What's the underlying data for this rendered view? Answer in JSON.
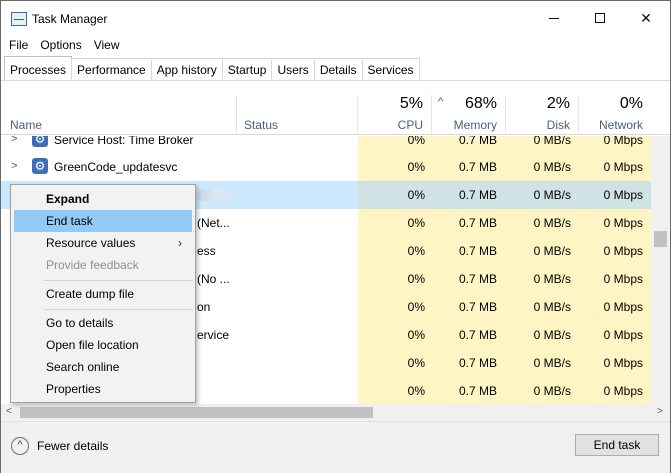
{
  "window": {
    "title": "Task Manager"
  },
  "menu": [
    "File",
    "Options",
    "View"
  ],
  "tabs": [
    "Processes",
    "Performance",
    "App history",
    "Startup",
    "Users",
    "Details",
    "Services"
  ],
  "header": {
    "name": "Name",
    "status": "Status",
    "cpu": {
      "pct": "5%",
      "label": "CPU"
    },
    "memory": {
      "pct": "68%",
      "label": "Memory"
    },
    "disk": {
      "pct": "2%",
      "label": "Disk"
    },
    "network": {
      "pct": "0%",
      "label": "Network"
    }
  },
  "rows": [
    {
      "name": "Service Host: Time Broker",
      "frag": "",
      "cpu": "0%",
      "mem": "0.7 MB",
      "disk": "0 MB/s",
      "net": "0 Mbps"
    },
    {
      "name": "GreenCode_updatesvc",
      "frag": "",
      "cpu": "0%",
      "mem": "0.7 MB",
      "disk": "0 MB/s",
      "net": "0 Mbps"
    },
    {
      "name": "",
      "frag": "",
      "cpu": "0%",
      "mem": "0.7 MB",
      "disk": "0 MB/s",
      "net": "0 Mbps"
    },
    {
      "name": "",
      "frag": "(Net...",
      "cpu": "0%",
      "mem": "0.7 MB",
      "disk": "0 MB/s",
      "net": "0 Mbps"
    },
    {
      "name": "",
      "frag": "ess",
      "cpu": "0%",
      "mem": "0.7 MB",
      "disk": "0 MB/s",
      "net": "0 Mbps"
    },
    {
      "name": "",
      "frag": "(No ...",
      "cpu": "0%",
      "mem": "0.7 MB",
      "disk": "0 MB/s",
      "net": "0 Mbps"
    },
    {
      "name": "",
      "frag": "on",
      "cpu": "0%",
      "mem": "0.7 MB",
      "disk": "0 MB/s",
      "net": "0 Mbps"
    },
    {
      "name": "",
      "frag": "ervice",
      "cpu": "0%",
      "mem": "0.7 MB",
      "disk": "0 MB/s",
      "net": "0 Mbps"
    },
    {
      "name": "",
      "frag": "",
      "cpu": "0%",
      "mem": "0.7 MB",
      "disk": "0 MB/s",
      "net": "0 Mbps"
    },
    {
      "name": "",
      "frag": "",
      "cpu": "0%",
      "mem": "0.7 MB",
      "disk": "0 MB/s",
      "net": "0 Mbps"
    }
  ],
  "context_menu": {
    "expand": "Expand",
    "end_task": "End task",
    "resource_values": "Resource values",
    "provide_feedback": "Provide feedback",
    "create_dump_file": "Create dump file",
    "go_to_details": "Go to details",
    "open_file_location": "Open file location",
    "search_online": "Search online",
    "properties": "Properties"
  },
  "footer": {
    "fewer_details": "Fewer details",
    "end_task": "End task"
  },
  "colors": {
    "usage_band": "#fff4c4",
    "selection": "#cce8ff",
    "menu_highlight": "#91c9f7"
  }
}
